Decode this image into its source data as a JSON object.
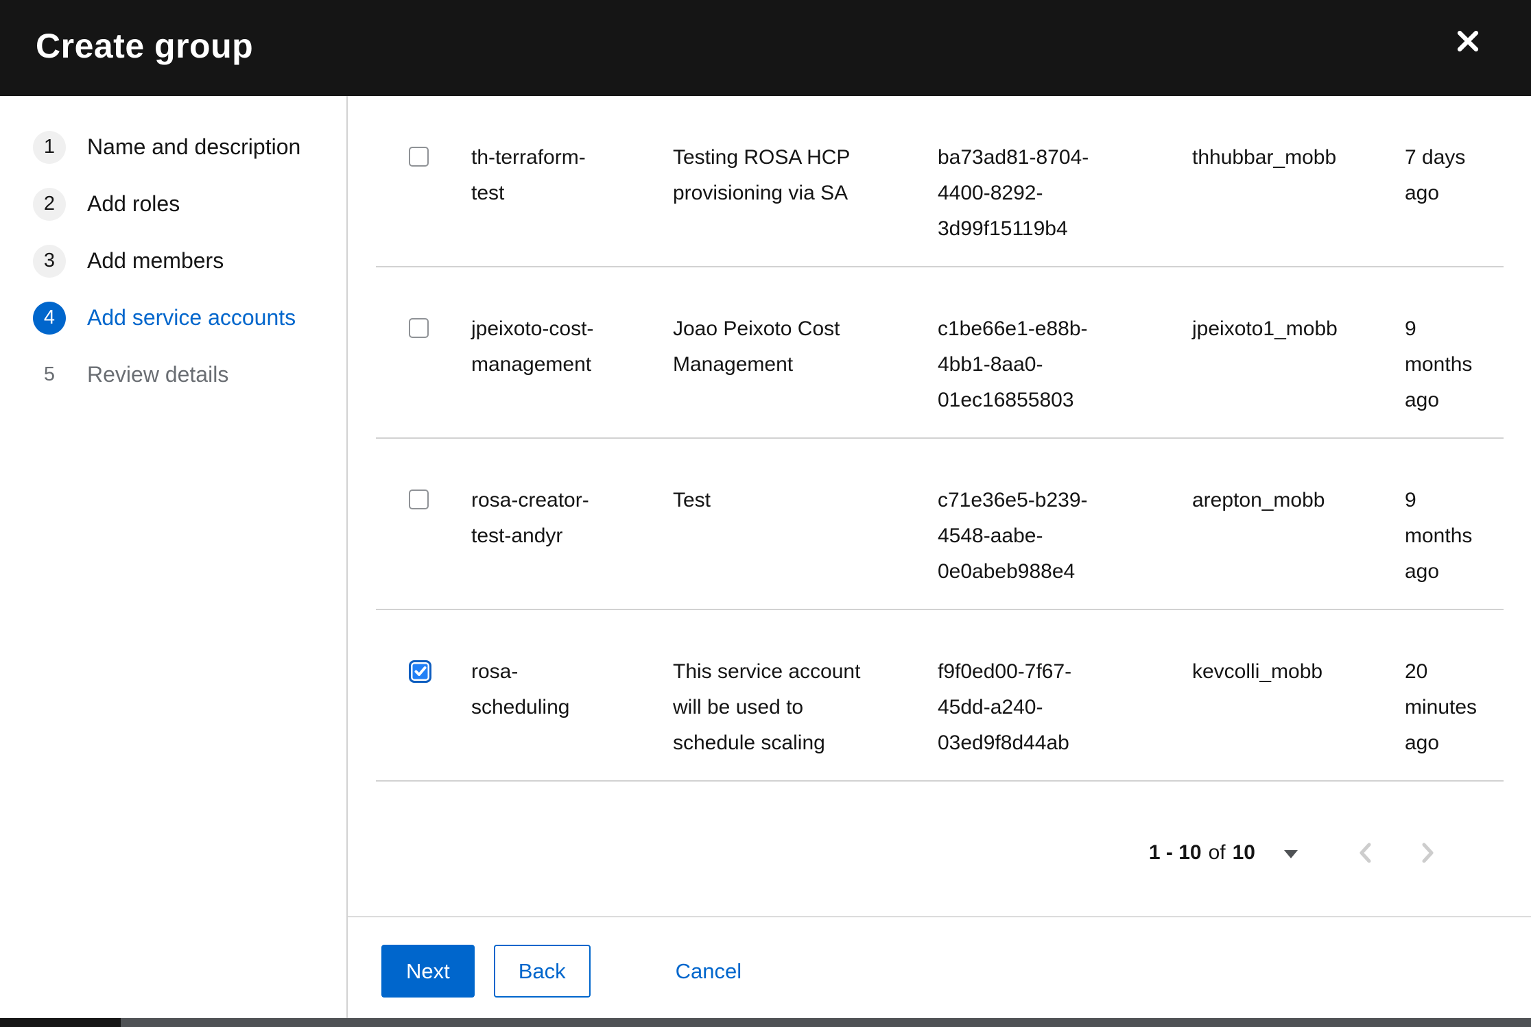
{
  "dialog": {
    "title": "Create group"
  },
  "steps": [
    {
      "num": "1",
      "label": "Name and description",
      "state": "done"
    },
    {
      "num": "2",
      "label": "Add roles",
      "state": "done"
    },
    {
      "num": "3",
      "label": "Add members",
      "state": "done"
    },
    {
      "num": "4",
      "label": "Add service accounts",
      "state": "current"
    },
    {
      "num": "5",
      "label": "Review details",
      "state": "future"
    }
  ],
  "table": {
    "rows": [
      {
        "checked": false,
        "name": "th-terraform-test",
        "description": "Testing ROSA HCP provisioning via SA",
        "client_id": "ba73ad81-8704-4400-8292-3d99f15119b4",
        "owner": "thhubbar_mobb",
        "time_created": "7 days ago"
      },
      {
        "checked": false,
        "name": "jpeixoto-cost-management",
        "description": "Joao Peixoto Cost Management",
        "client_id": "c1be66e1-e88b-4bb1-8aa0-01ec16855803",
        "owner": "jpeixoto1_mobb",
        "time_created": "9 months ago"
      },
      {
        "checked": false,
        "name": "rosa-creator-test-andyr",
        "description": "Test",
        "client_id": "c71e36e5-b239-4548-aabe-0e0abeb988e4",
        "owner": "arepton_mobb",
        "time_created": "9 months ago"
      },
      {
        "checked": true,
        "name": "rosa-scheduling",
        "description": "This service account will be used to schedule scaling",
        "client_id": "f9f0ed00-7f67-45dd-a240-03ed9f8d44ab",
        "owner": "kevcolli_mobb",
        "time_created": "20 minutes ago"
      }
    ]
  },
  "pagination": {
    "range": "1 - 10",
    "of_label": "of",
    "total": "10"
  },
  "footer": {
    "next_label": "Next",
    "back_label": "Back",
    "cancel_label": "Cancel"
  },
  "colors": {
    "accent": "#0066cc",
    "header_bg": "#151515",
    "row_border": "#d2d2d2",
    "muted_text": "#6a6e73",
    "checkbox_border": "#8f9296",
    "scrollbar_track": "#4f5255",
    "scrollbar_thumb": "#161616"
  }
}
